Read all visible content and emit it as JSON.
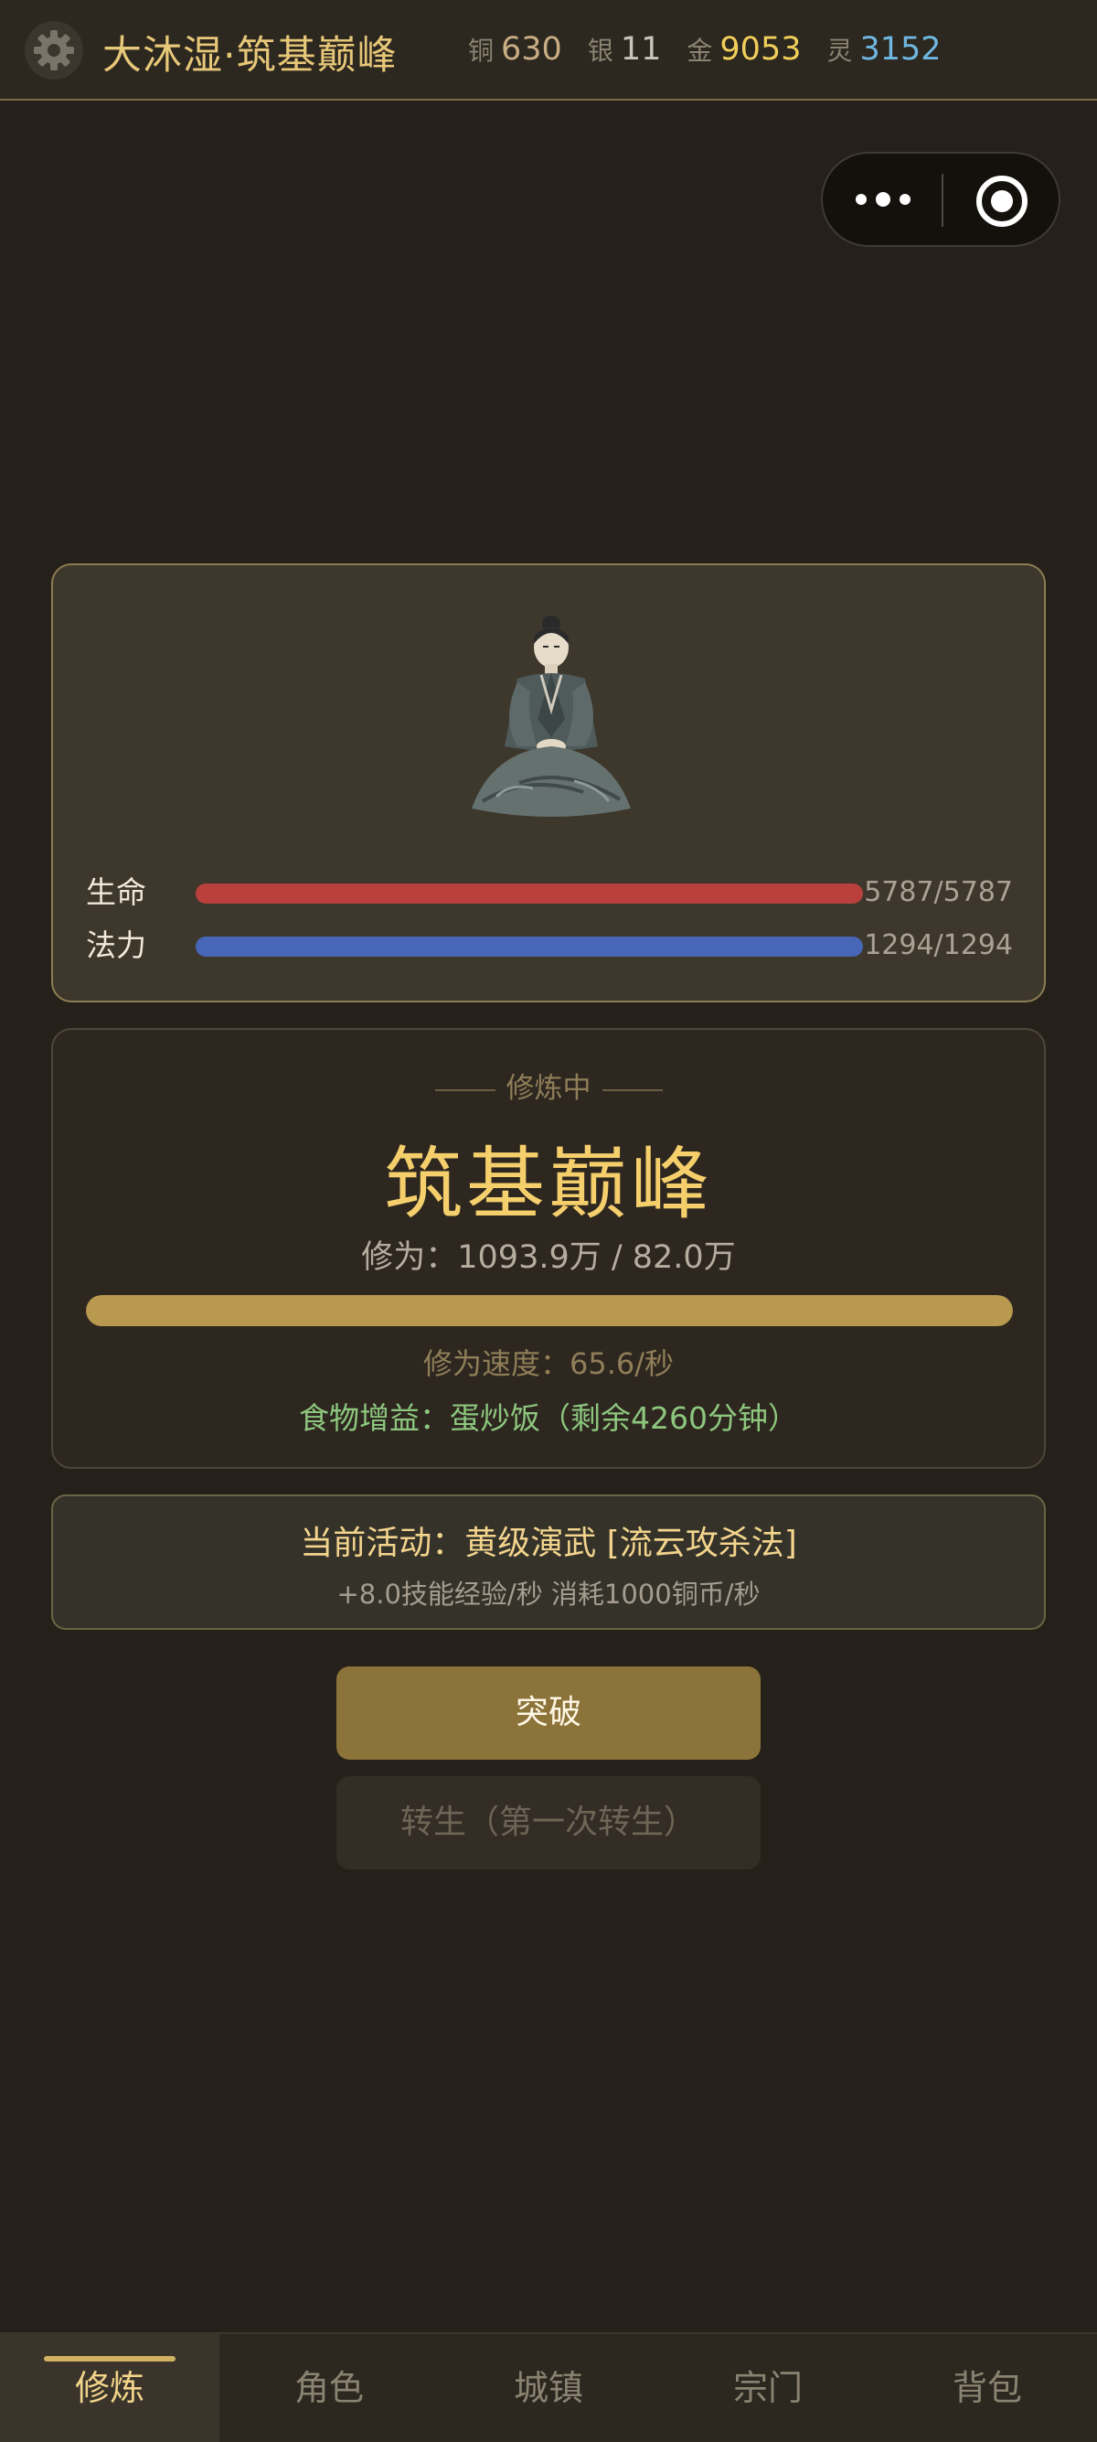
{
  "header": {
    "title": "大沐湿·筑基巅峰",
    "currencies": [
      {
        "label": "铜",
        "value": "630"
      },
      {
        "label": "银",
        "value": "11"
      },
      {
        "label": "金",
        "value": "9053"
      },
      {
        "label": "灵",
        "value": "3152"
      }
    ]
  },
  "character": {
    "hp_label": "生命",
    "hp_value": "5787/5787",
    "hp_fraction": 1.0,
    "mp_label": "法力",
    "mp_value": "1294/1294",
    "mp_fraction": 1.0
  },
  "cultivation": {
    "status": "修炼中",
    "realm": "筑基巅峰",
    "xiuwei": "修为：1093.9万 / 82.0万",
    "progress_fraction": 1.0,
    "speed": "修为速度：65.6/秒",
    "food": "食物增益：蛋炒饭（剩余4260分钟）"
  },
  "activity": {
    "title": "当前活动：黄级演武 [流云攻杀法]",
    "sub": "+8.0技能经验/秒  消耗1000铜币/秒"
  },
  "buttons": {
    "breakthrough": "突破",
    "rebirth": "转生（第一次转生）"
  },
  "nav": {
    "items": [
      "修炼",
      "角色",
      "城镇",
      "宗门",
      "背包"
    ],
    "active_index": 0
  },
  "colors": {
    "accent_gold": "#f5cf6b",
    "hp_bar": "#b9403c",
    "mp_bar": "#4766b6",
    "progress_bar": "#b9994e",
    "food_text": "#8dc77e",
    "spirit_currency": "#6fb7e0"
  }
}
